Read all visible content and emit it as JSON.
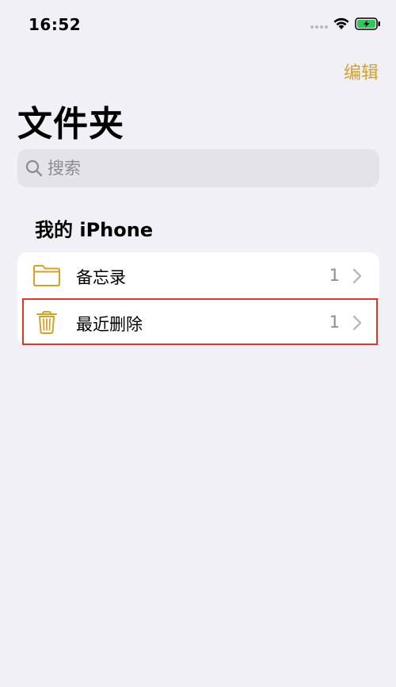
{
  "status_bar": {
    "time": "16:52"
  },
  "header": {
    "edit_label": "编辑",
    "title": "文件夹"
  },
  "search": {
    "placeholder": "搜索",
    "value": ""
  },
  "section": {
    "title": "我的 iPhone"
  },
  "folders": [
    {
      "label": "备忘录",
      "count": "1",
      "icon": "folder-icon"
    },
    {
      "label": "最近删除",
      "count": "1",
      "icon": "trash-icon"
    }
  ],
  "colors": {
    "accent": "#d3a22a",
    "background": "#f1f0f6",
    "highlight": "#d8372f"
  }
}
